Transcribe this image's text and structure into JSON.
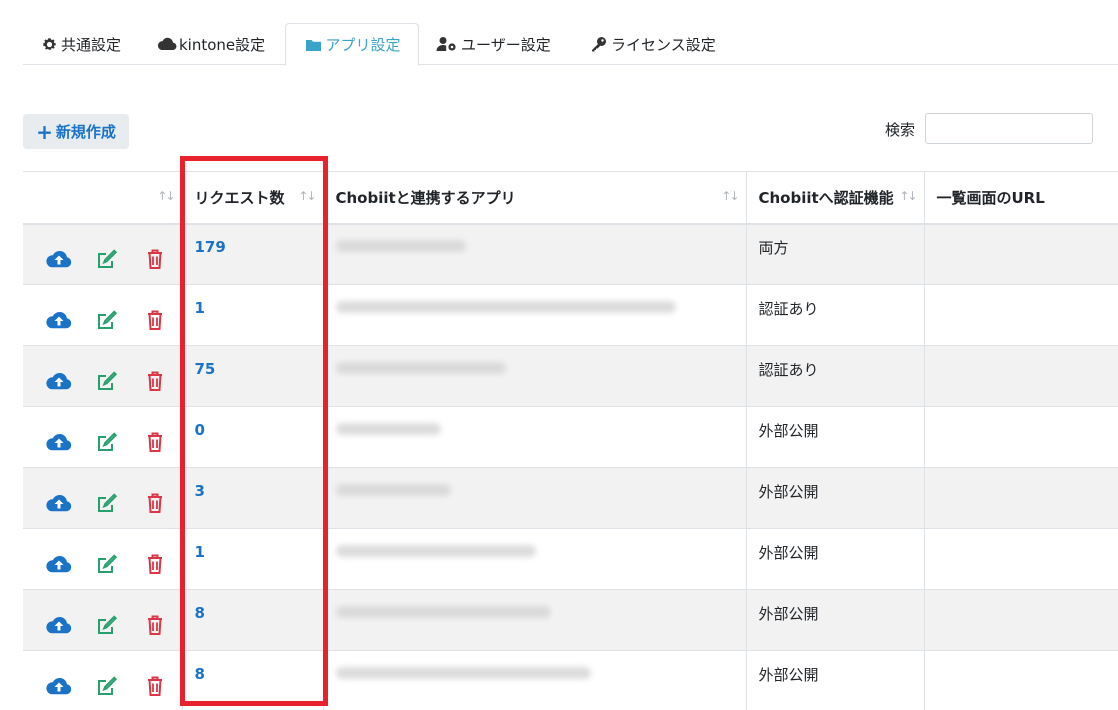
{
  "tabs": [
    {
      "label": "共通設定",
      "icon": "gear-icon",
      "active": false
    },
    {
      "label": "kintone設定",
      "icon": "cloud-icon",
      "active": false
    },
    {
      "label": "アプリ設定",
      "icon": "folder-icon",
      "active": true
    },
    {
      "label": "ユーザー設定",
      "icon": "user-cog-icon",
      "active": false
    },
    {
      "label": "ライセンス設定",
      "icon": "key-icon",
      "active": false
    }
  ],
  "toolbar": {
    "new_button_label": "新規作成",
    "search_label": "検索",
    "search_value": ""
  },
  "table": {
    "columns": [
      {
        "label": "",
        "sortable": true
      },
      {
        "label": "リクエスト数",
        "sortable": true
      },
      {
        "label": "Chobiitと連携するアプリ",
        "sortable": true
      },
      {
        "label": "Chobiitへ認証機能",
        "sortable": true
      },
      {
        "label": "一覧画面のURL",
        "sortable": false
      }
    ],
    "rows": [
      {
        "count": "179",
        "auth": "両方",
        "url": ""
      },
      {
        "count": "1",
        "auth": "認証あり",
        "url": ""
      },
      {
        "count": "75",
        "auth": "認証あり",
        "url": ""
      },
      {
        "count": "0",
        "auth": "外部公開",
        "url": ""
      },
      {
        "count": "3",
        "auth": "外部公開",
        "url": ""
      },
      {
        "count": "1",
        "auth": "外部公開",
        "url": ""
      },
      {
        "count": "8",
        "auth": "外部公開",
        "url": ""
      },
      {
        "count": "8",
        "auth": "外部公開",
        "url": ""
      }
    ]
  },
  "colors": {
    "accent": "#1a73c7",
    "active_tab": "#3aa3c8",
    "edit_icon": "#28a06e",
    "delete_icon": "#dc3545",
    "highlight": "#e8222d"
  }
}
